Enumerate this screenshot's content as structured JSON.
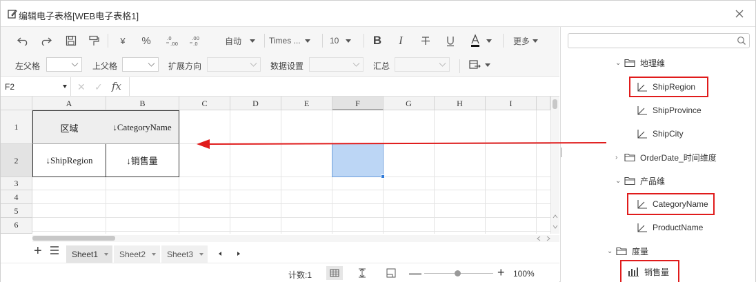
{
  "dialog": {
    "title": "编辑电子表格[WEB电子表格1]"
  },
  "toolbar": {
    "currency": "¥",
    "percent": "%",
    "dec_inc": ".0 .00",
    "dec_dec": ".00 .0",
    "format": "自动",
    "font": "Times ...",
    "size": "10",
    "more": "更多",
    "row2": {
      "left_parent": "左父格",
      "top_parent": "上父格",
      "expand_dir": "扩展方向",
      "data_setting": "数据设置",
      "summary": "汇总"
    }
  },
  "formula_bar": {
    "cell_ref": "F2",
    "cancel": "✕",
    "ok": "✓",
    "fx": "fx"
  },
  "grid": {
    "columns": [
      "A",
      "B",
      "C",
      "D",
      "E",
      "F",
      "G",
      "H",
      "I"
    ],
    "rows": [
      "1",
      "2",
      "3",
      "4",
      "5",
      "6"
    ],
    "cells": {
      "A1": "区域",
      "B1": "↓CategoryName",
      "A2": "↓ShipRegion",
      "B2": "↓销售量"
    },
    "selected": "F2"
  },
  "sheets": {
    "tabs": [
      "Sheet1",
      "Sheet2",
      "Sheet3"
    ],
    "active": "Sheet1"
  },
  "status": {
    "count": "计数:1",
    "zoom": "100%",
    "zoom_level": 0.5
  },
  "panel": {
    "search_placeholder": "",
    "tree": [
      {
        "label": "地理维",
        "type": "folder",
        "expanded": true
      },
      {
        "label": "ShipRegion",
        "type": "dim",
        "highlighted": true
      },
      {
        "label": "ShipProvince",
        "type": "dim"
      },
      {
        "label": "ShipCity",
        "type": "dim"
      },
      {
        "label": "OrderDate_时间维度",
        "type": "folder",
        "expanded": false
      },
      {
        "label": "产品维",
        "type": "folder",
        "expanded": true
      },
      {
        "label": "CategoryName",
        "type": "dim",
        "highlighted": true
      },
      {
        "label": "ProductName",
        "type": "dim"
      },
      {
        "label": "度量",
        "type": "folder",
        "expanded": true
      },
      {
        "label": "销售量",
        "type": "measure",
        "highlighted": true
      }
    ]
  },
  "colors": {
    "highlight": "#e01b1b",
    "arrow": "#e01b1b",
    "selected_cell": "#bcd6f5",
    "header_bg": "#f3f3f3"
  }
}
